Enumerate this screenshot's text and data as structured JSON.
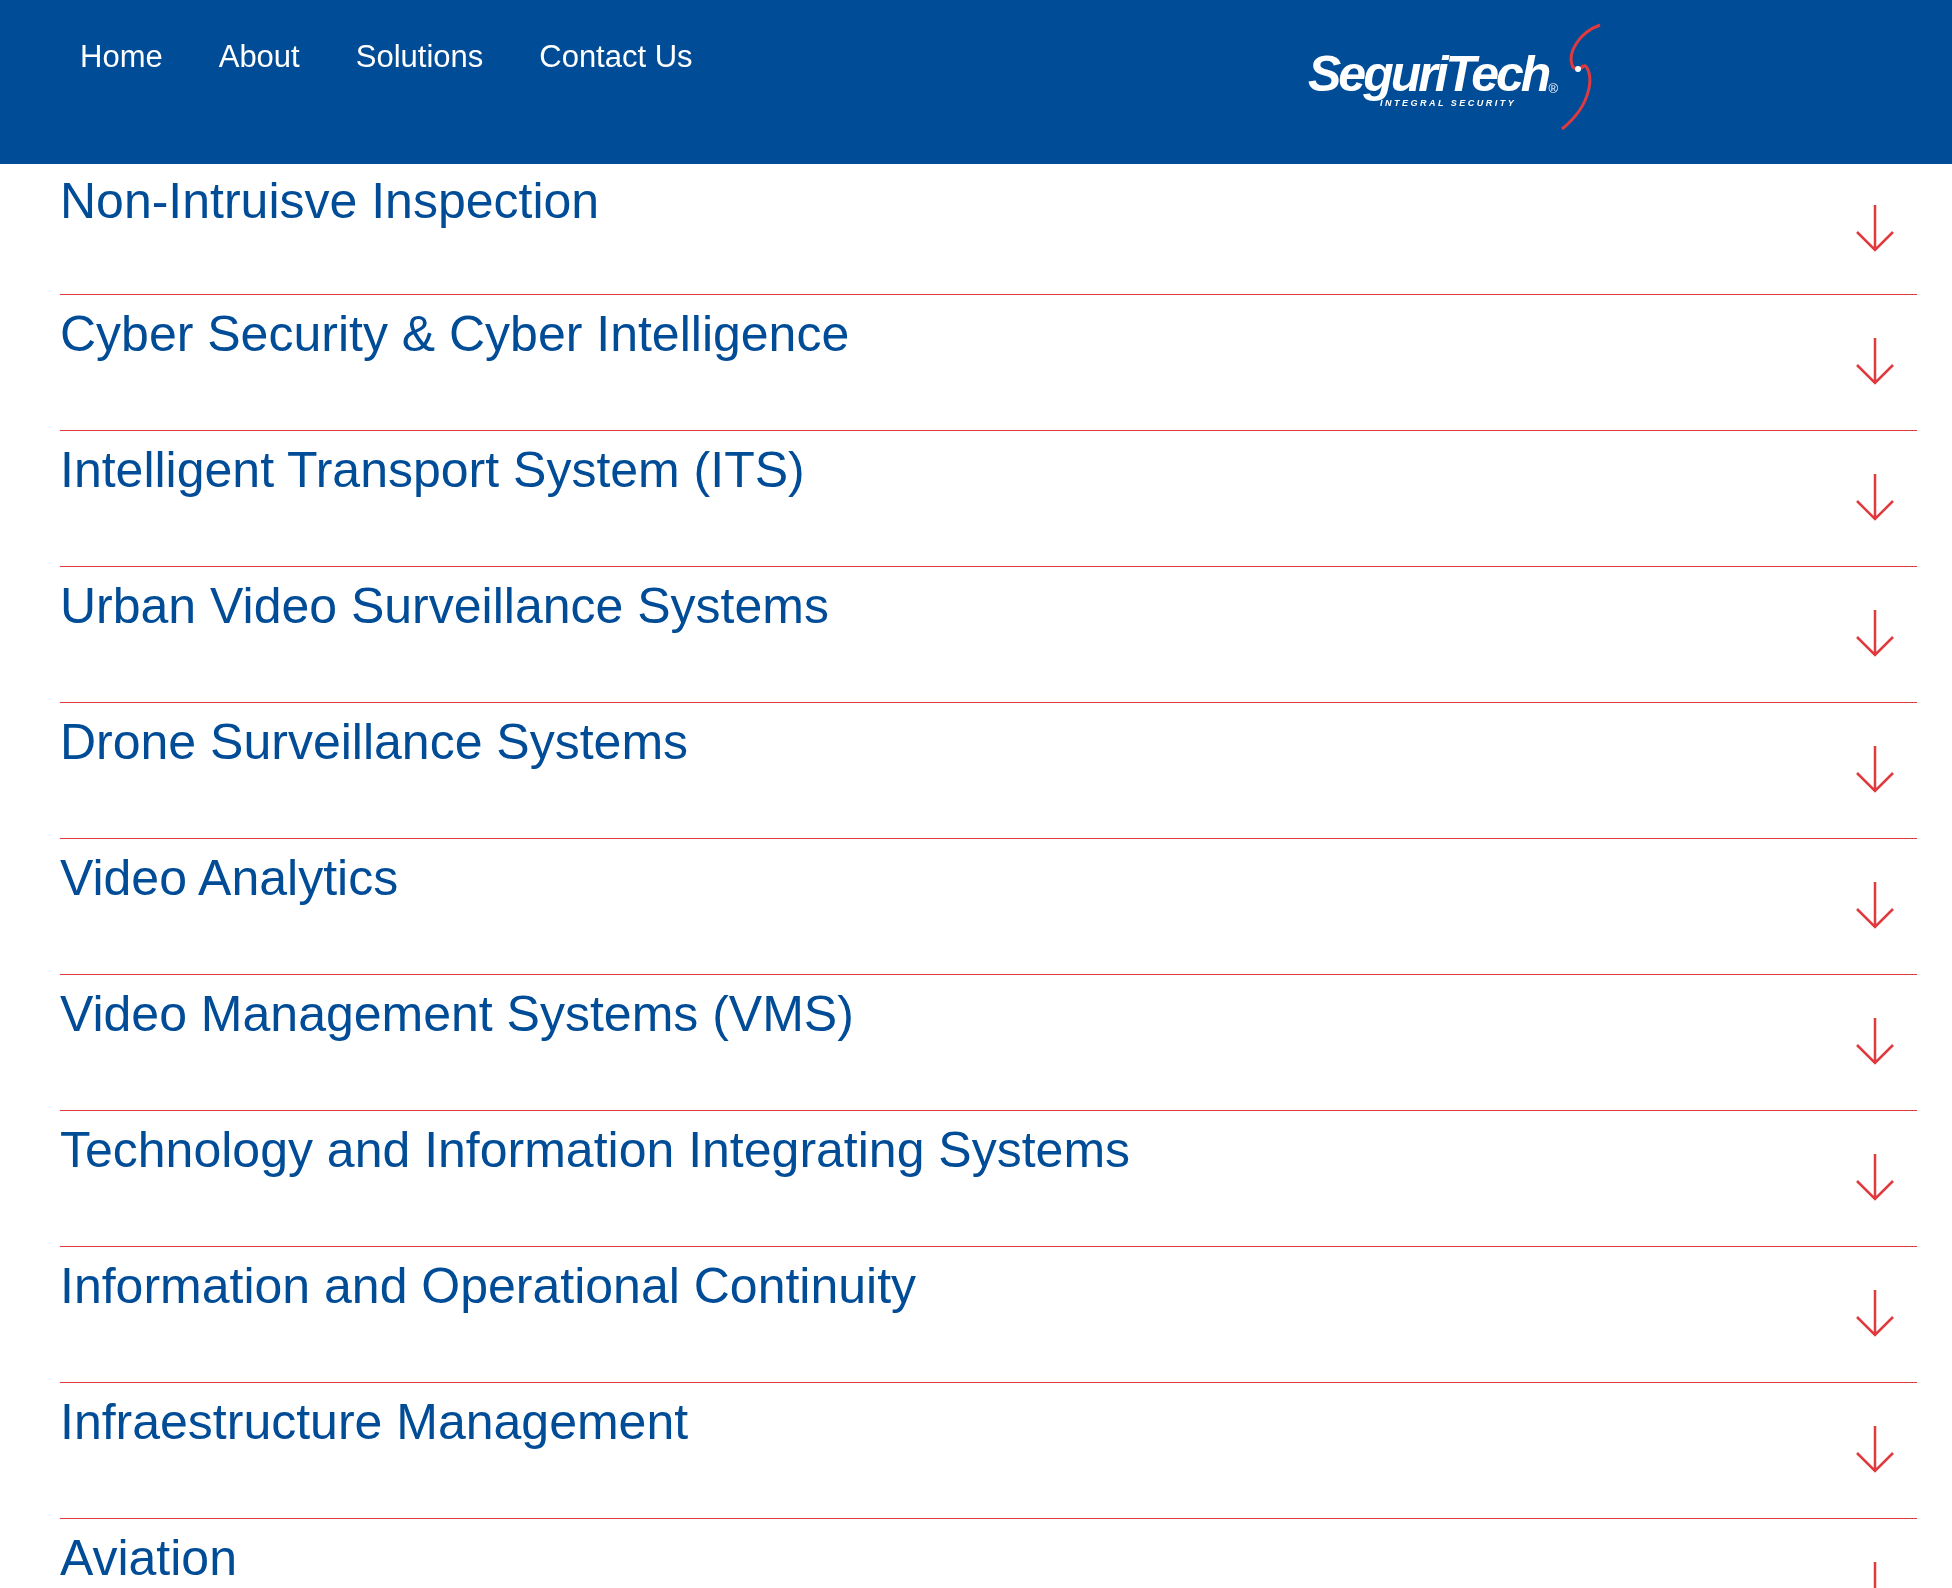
{
  "nav": {
    "links": [
      "Home",
      "About",
      "Solutions",
      "Contact Us"
    ]
  },
  "logo": {
    "name": "SeguriTech",
    "registered": "®",
    "tagline": "INTEGRAL SECURITY"
  },
  "solutions": [
    {
      "title": "Non-Intruisve Inspection",
      "expanded": false
    },
    {
      "title": "Cyber Security & Cyber Intelligence",
      "expanded": false
    },
    {
      "title": "Intelligent Transport System (ITS)",
      "expanded": false
    },
    {
      "title": "Urban Video Surveillance Systems",
      "expanded": false
    },
    {
      "title": "Drone Surveillance Systems",
      "expanded": false
    },
    {
      "title": "Video Analytics",
      "expanded": false
    },
    {
      "title": "Video Management Systems (VMS)",
      "expanded": false
    },
    {
      "title": "Technology and Information Integrating Systems",
      "expanded": false
    },
    {
      "title": "Information and Operational Continuity",
      "expanded": false
    },
    {
      "title": "Infraestructure Management",
      "expanded": false
    },
    {
      "title": "Aviation",
      "expanded": false
    }
  ]
}
